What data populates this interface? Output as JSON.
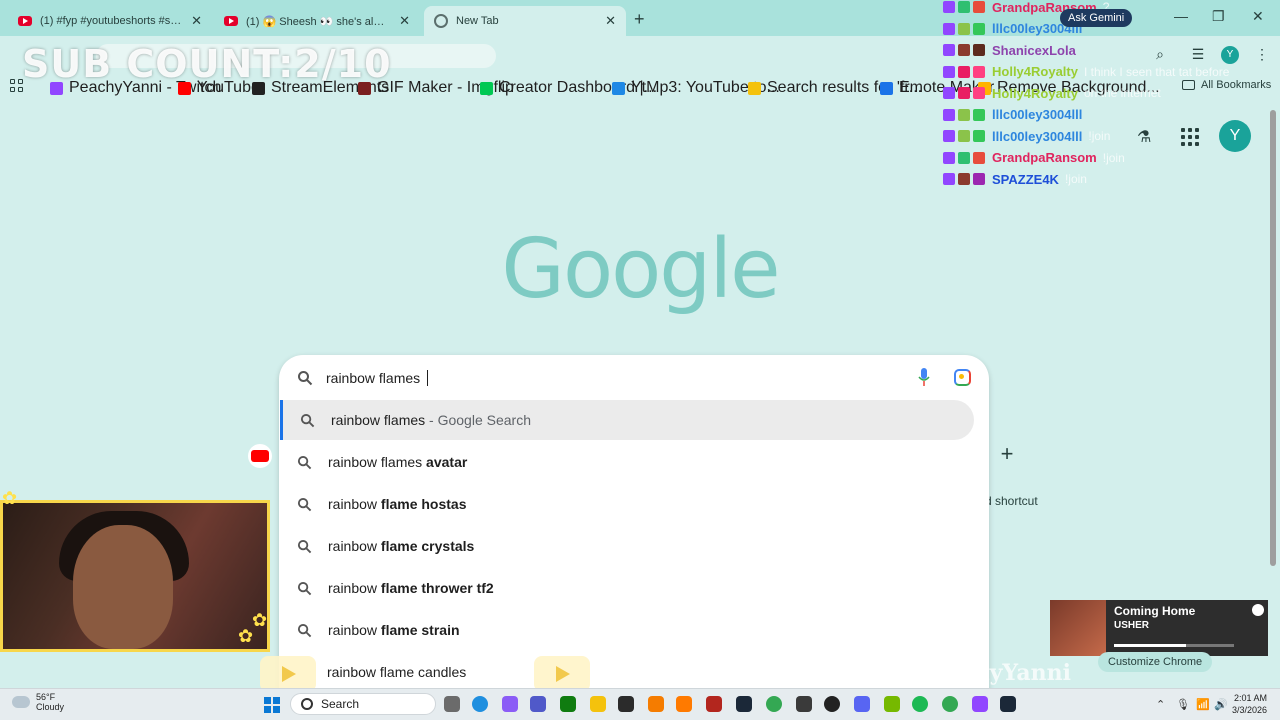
{
  "tabs": [
    {
      "title": "(1) #fyp #youtubeshorts #short"
    },
    {
      "title": "(1) 😱 Sheesh 👀 she's always"
    },
    {
      "title": "New Tab"
    }
  ],
  "overlay": {
    "sub_count": "SUB COUNT:2/10",
    "handle": "PeachyYanni"
  },
  "bookmarks": [
    {
      "label": "PeachyYanni - Twitch",
      "color": "#9146ff"
    },
    {
      "label": "YouTube",
      "color": "#ff0000"
    },
    {
      "label": "StreamElements",
      "color": "#222222"
    },
    {
      "label": "GIF Maker - Imgflip",
      "color": "#7a1f1f"
    },
    {
      "label": "Creator Dashboard |...",
      "color": "#00c853"
    },
    {
      "label": "YtMp3: YouTube to...",
      "color": "#1e88e5"
    },
    {
      "label": "Search results for 'fr...",
      "color": "#f4c20d"
    },
    {
      "label": "Emote Maker",
      "color": "#1a73e8"
    },
    {
      "label": "Remove Background...",
      "color": "#ffb300"
    }
  ],
  "all_bookmarks": "All Bookmarks",
  "ntp": {
    "logo": "Google",
    "avatar_letter": "Y",
    "shortcut_label": "d shortcut",
    "customize": "Customize Chrome"
  },
  "search": {
    "query": "rainbow flames ",
    "suggestions": [
      {
        "base": "rainbow flames",
        "bold": "",
        "suffix": " - Google Search"
      },
      {
        "base": "rainbow flames ",
        "bold": "avatar",
        "suffix": ""
      },
      {
        "base": "rainbow ",
        "bold": "flame hostas",
        "suffix": ""
      },
      {
        "base": "rainbow ",
        "bold": "flame crystals",
        "suffix": ""
      },
      {
        "base": "rainbow ",
        "bold": "flame thrower tf2",
        "suffix": ""
      },
      {
        "base": "rainbow ",
        "bold": "flame strain",
        "suffix": ""
      }
    ],
    "cut_row": "rainbow flame candles"
  },
  "chat": [
    {
      "user": "GrandpaRansom",
      "color": "#e0245e",
      "msg": "?"
    },
    {
      "user": "lllc00ley3004lll",
      "color": "#2e86de",
      "msg": ""
    },
    {
      "user": "ShanicexLola",
      "color": "#8e44ad",
      "msg": ""
    },
    {
      "user": "Holly4Royalty",
      "color": "#9acd32",
      "msg": "I think I seen that tat before"
    },
    {
      "user": "Holly4Royalty",
      "color": "#9acd32",
      "msg": "on the internet"
    },
    {
      "user": "lllc00ley3004lll",
      "color": "#2e86de",
      "msg": ""
    },
    {
      "user": "lllc00ley3004lll",
      "color": "#2e86de",
      "msg": "!join"
    },
    {
      "user": "GrandpaRansom",
      "color": "#e0245e",
      "msg": "!join"
    },
    {
      "user": "SPAZZE4K",
      "color": "#1e4fd8",
      "msg": "!join"
    }
  ],
  "gemini": "Ask Gemini",
  "spotify": {
    "song": "Coming Home",
    "artist": "USHER",
    "progress": 0.6
  },
  "taskbar": {
    "temp": "56°F",
    "condition": "Cloudy",
    "search": "Search",
    "time": "2:01 AM",
    "date": "3/3/2026"
  }
}
